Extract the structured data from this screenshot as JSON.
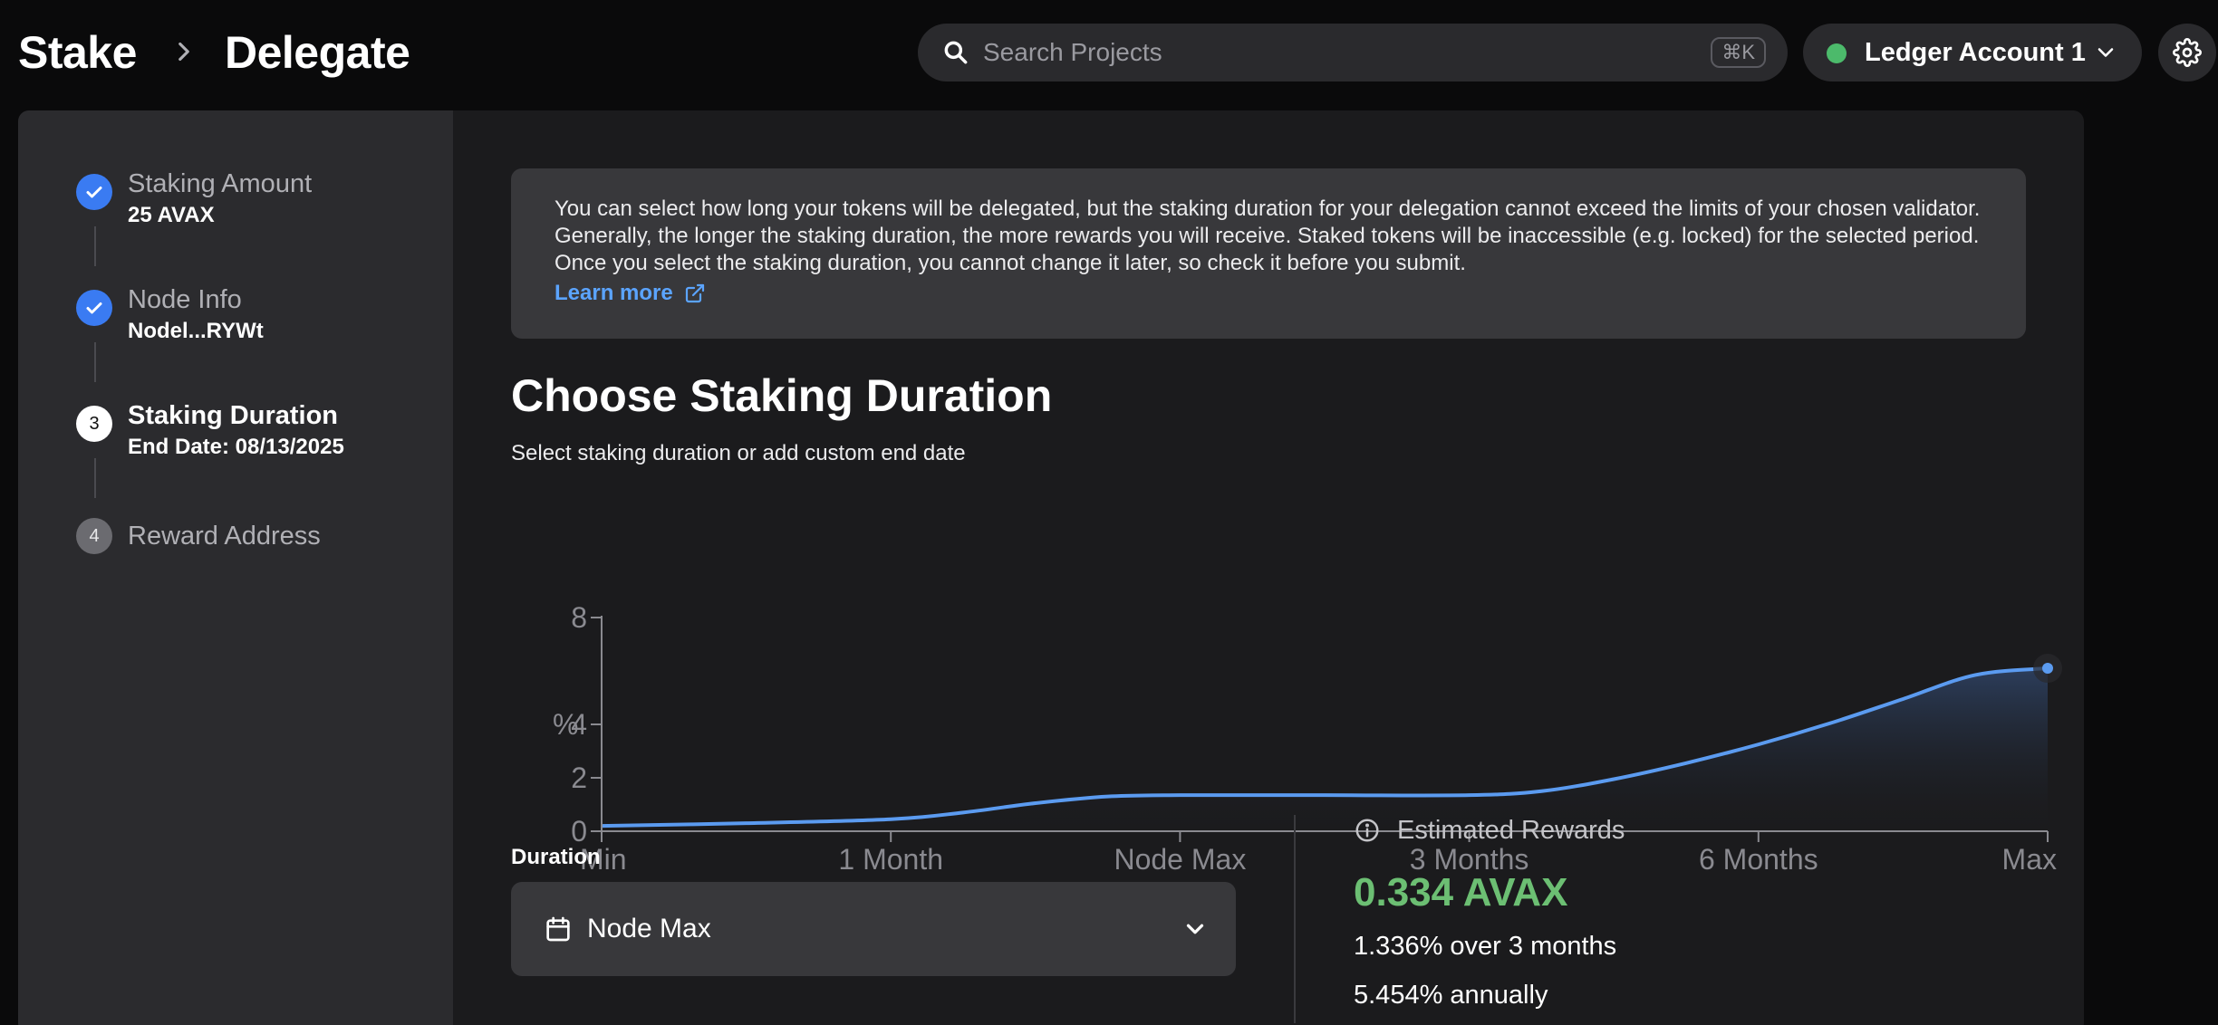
{
  "breadcrumb": {
    "root": "Stake",
    "current": "Delegate"
  },
  "search": {
    "placeholder": "Search Projects",
    "shortcut": "⌘K"
  },
  "account": {
    "label": "Ledger Account 1",
    "status_color": "#4cba6b"
  },
  "steps": [
    {
      "number": "1",
      "title": "Staking Amount",
      "value": "25 AVAX",
      "state": "done"
    },
    {
      "number": "2",
      "title": "Node Info",
      "value": "Nodel...RYWt",
      "state": "done"
    },
    {
      "number": "3",
      "title": "Staking Duration",
      "value": "End Date: 08/13/2025",
      "state": "current"
    },
    {
      "number": "4",
      "title": "Reward Address",
      "state": "todo"
    }
  ],
  "info": {
    "text": "You can select how long your tokens will be delegated, but the staking duration for your delegation cannot exceed the limits of your chosen validator. Generally, the longer the staking duration, the more rewards you will receive. Staked tokens will be inaccessible (e.g. locked) for the selected period. Once you select the staking duration, you cannot change it later, so check it before you submit.",
    "link_label": "Learn more"
  },
  "section": {
    "title": "Choose Staking Duration",
    "subtitle": "Select staking duration or add custom end date"
  },
  "chart_data": {
    "type": "area",
    "x_categories": [
      "Min",
      "1 Month",
      "Node Max",
      "3 Months",
      "6 Months",
      "Max"
    ],
    "x": [
      0,
      0.5,
      1,
      1.25,
      1.5,
      1.75,
      2,
      2.25,
      2.5,
      3,
      3.25,
      3.5,
      3.75,
      4,
      4.25,
      4.5,
      4.75,
      5
    ],
    "y": [
      0.2,
      0.3,
      0.45,
      0.7,
      1.05,
      1.3,
      1.35,
      1.35,
      1.35,
      1.35,
      1.5,
      1.95,
      2.55,
      3.25,
      4.05,
      4.95,
      5.85,
      6.1
    ],
    "ylabel": "%",
    "y_ticks": [
      0,
      2,
      4,
      8
    ],
    "ylim": [
      0,
      8
    ],
    "line_color": "#5b9bf0",
    "grid": false
  },
  "duration": {
    "label": "Duration",
    "value": "Node Max"
  },
  "rewards": {
    "label": "Estimated Rewards",
    "amount": "0.334 AVAX",
    "period": "1.336% over 3 months",
    "annual": "5.454% annually",
    "amount_color": "#6cbf73"
  }
}
